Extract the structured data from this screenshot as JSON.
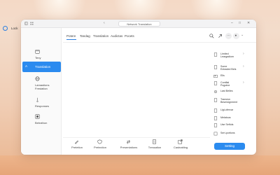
{
  "window": {
    "title": "Network Translation"
  },
  "account": {
    "name": "Lock"
  },
  "sidebar": {
    "items": [
      {
        "label": "Teny",
        "icon": "calendar-icon"
      },
      {
        "label": "Translation",
        "icon": "translate-icon",
        "active": true
      },
      {
        "label": "Lamastions\nFrestation",
        "icon": "globe-icon"
      },
      {
        "label": "Responses",
        "icon": "pen-icon"
      },
      {
        "label": "Betrathon",
        "icon": "box-icon"
      }
    ]
  },
  "tabs": [
    "Potere",
    "Tandag",
    "Translation",
    "Audictas",
    "Pocets"
  ],
  "right_panel": {
    "items": [
      {
        "label": "Limited\nLeargadiom",
        "icon": "document-icon",
        "chevron": true
      },
      {
        "label": "Some\nExtraded Bels",
        "icon": "document-icon",
        "chevron": true
      },
      {
        "label": "Ells",
        "icon": "image-icon",
        "chevron": false
      },
      {
        "label": "Contfial\nPogotne",
        "icon": "document-icon",
        "chevron": true
      },
      {
        "label": "Last Belles",
        "icon": "settings-icon",
        "chevron": false
      },
      {
        "label": "Transion\nBesersignment",
        "icon": "document-icon",
        "chevron": false
      },
      {
        "label": "Ligt-ofervar",
        "icon": "document-icon",
        "chevron": false
      },
      {
        "label": "Melatous",
        "icon": "document-icon",
        "chevron": false
      },
      {
        "label": "Use Setfuls",
        "icon": "document-icon",
        "chevron": false
      },
      {
        "label": "Sert-portions",
        "icon": "checkbox-icon",
        "chevron": false
      }
    ],
    "button": "Setting"
  },
  "bottom_bar": {
    "items": [
      {
        "label": "Pretetion",
        "icon": "draw-icon"
      },
      {
        "label": "Pretection",
        "icon": "shield-icon"
      },
      {
        "label": "Presentations",
        "icon": "transfer-icon"
      },
      {
        "label": "Tressation",
        "icon": "document-icon"
      },
      {
        "label": "Castnatting",
        "icon": "export-icon"
      }
    ]
  },
  "colors": {
    "accent": "#2b8bef"
  }
}
